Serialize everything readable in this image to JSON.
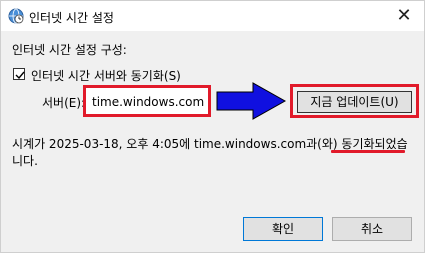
{
  "window": {
    "title": "인터넷 시간 설정",
    "close_glyph": "✕"
  },
  "content": {
    "section_label": "인터넷 시간 설정 구성:",
    "sync_checkbox": {
      "label": "인터넷 시간 서버와 동기화(S)",
      "checked": true
    },
    "server_label": "서버(E):",
    "server_value": "time.windows.com",
    "update_button": "지금 업데이트(U)",
    "status_line1": "시계가 2025-03-18, 오후 4:05에 time.windows.com과(와) 동기화되었습",
    "status_line2": "니다."
  },
  "footer": {
    "ok_label": "확인",
    "cancel_label": "취소"
  },
  "icons": {
    "app_icon": "clock-globe-icon",
    "arrow": "blue-arrow-icon"
  },
  "colors": {
    "highlight_red": "#e11a2a",
    "arrow_blue": "#1010e0",
    "ok_border": "#0078d7"
  }
}
